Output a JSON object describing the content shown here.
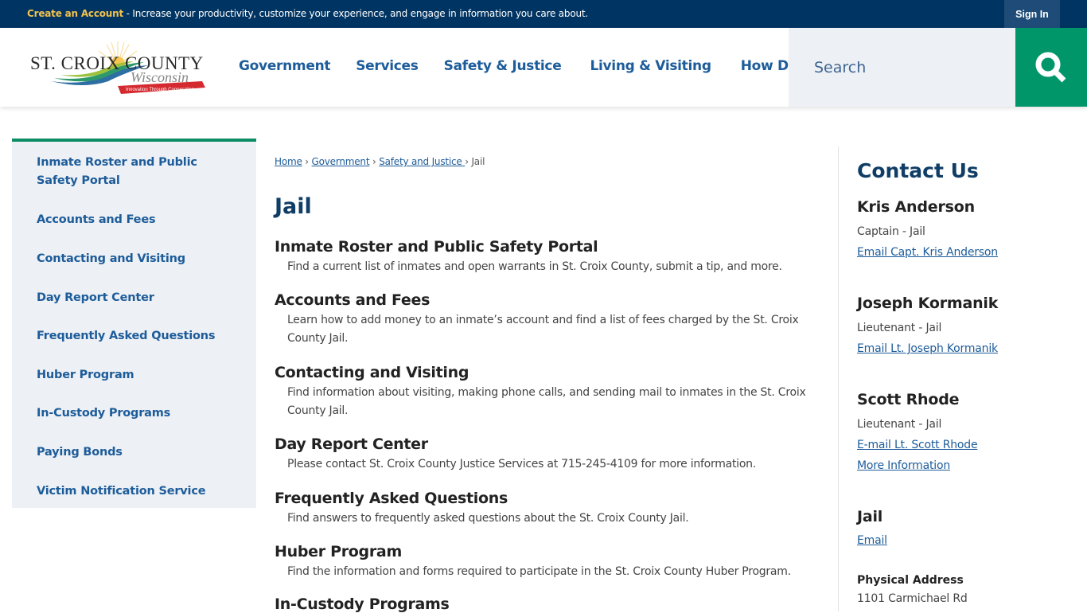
{
  "topbar": {
    "create_account": "Create an Account",
    "promo_text": " - Increase your productivity, customize your experience, and engage in information you care about.",
    "sign_in": "Sign In"
  },
  "header": {
    "logo": {
      "line1": "ST. CROIX COUNTY",
      "line2": "Wisconsin",
      "tagline": "Innovation Through Cooperation"
    },
    "nav": [
      "Government",
      "Services",
      "Safety & Justice",
      "Living & Visiting",
      "How Do I..."
    ],
    "search": {
      "placeholder": "Search",
      "value": ""
    }
  },
  "colors": {
    "topbar": "#003462",
    "accent_green": "#00966a",
    "link_blue": "#1d5c9a",
    "title_navy": "#0f3d66",
    "promo_gold": "#f2c14e"
  },
  "sidebar": {
    "items": [
      "Inmate Roster and Public Safety Portal",
      "Accounts and Fees",
      "Contacting and Visiting",
      "Day Report Center",
      "Frequently Asked Questions",
      "Huber Program",
      "In-Custody Programs",
      "Paying Bonds",
      "Victim Notification Service"
    ]
  },
  "breadcrumb": {
    "items": [
      "Home",
      "Government",
      "Safety and Justice "
    ],
    "current": "Jail",
    "separator": "›"
  },
  "main": {
    "title": "Jail",
    "entries": [
      {
        "title": "Inmate Roster and Public Safety Portal",
        "desc": "Find a current list of inmates and open warrants in St. Croix County, submit a tip, and more."
      },
      {
        "title": "Accounts and Fees",
        "desc": "Learn how to add money to an inmate’s account and find a list of fees charged by the St. Croix County Jail."
      },
      {
        "title": "Contacting and Visiting",
        "desc": "Find information about visiting, making phone calls, and sending mail to inmates in the St. Croix County Jail."
      },
      {
        "title": "Day Report Center",
        "desc": "Please contact St. Croix County Justice Services at 715-245-4109 for more information."
      },
      {
        "title": "Frequently Asked Questions",
        "desc": "Find answers to frequently asked questions about the St. Croix County Jail."
      },
      {
        "title": "Huber Program",
        "desc": "Find the information and forms required to participate in the St. Croix County Huber Program."
      },
      {
        "title": "In-Custody Programs",
        "desc": ""
      }
    ]
  },
  "contact": {
    "heading": "Contact Us",
    "people": [
      {
        "name": "Kris Anderson",
        "role": "Captain - Jail",
        "links": [
          "Email Capt. Kris Anderson"
        ]
      },
      {
        "name": "Joseph Kormanik",
        "role": "Lieutenant - Jail",
        "links": [
          "Email Lt. Joseph Kormanik"
        ]
      },
      {
        "name": "Scott Rhode",
        "role": "Lieutenant - Jail",
        "links": [
          "E-mail Lt. Scott Rhode",
          "More Information"
        ]
      }
    ],
    "department": {
      "name": "Jail",
      "email_label": "Email",
      "address_label": "Physical Address",
      "address_line1": "1101 Carmichael Rd"
    }
  }
}
